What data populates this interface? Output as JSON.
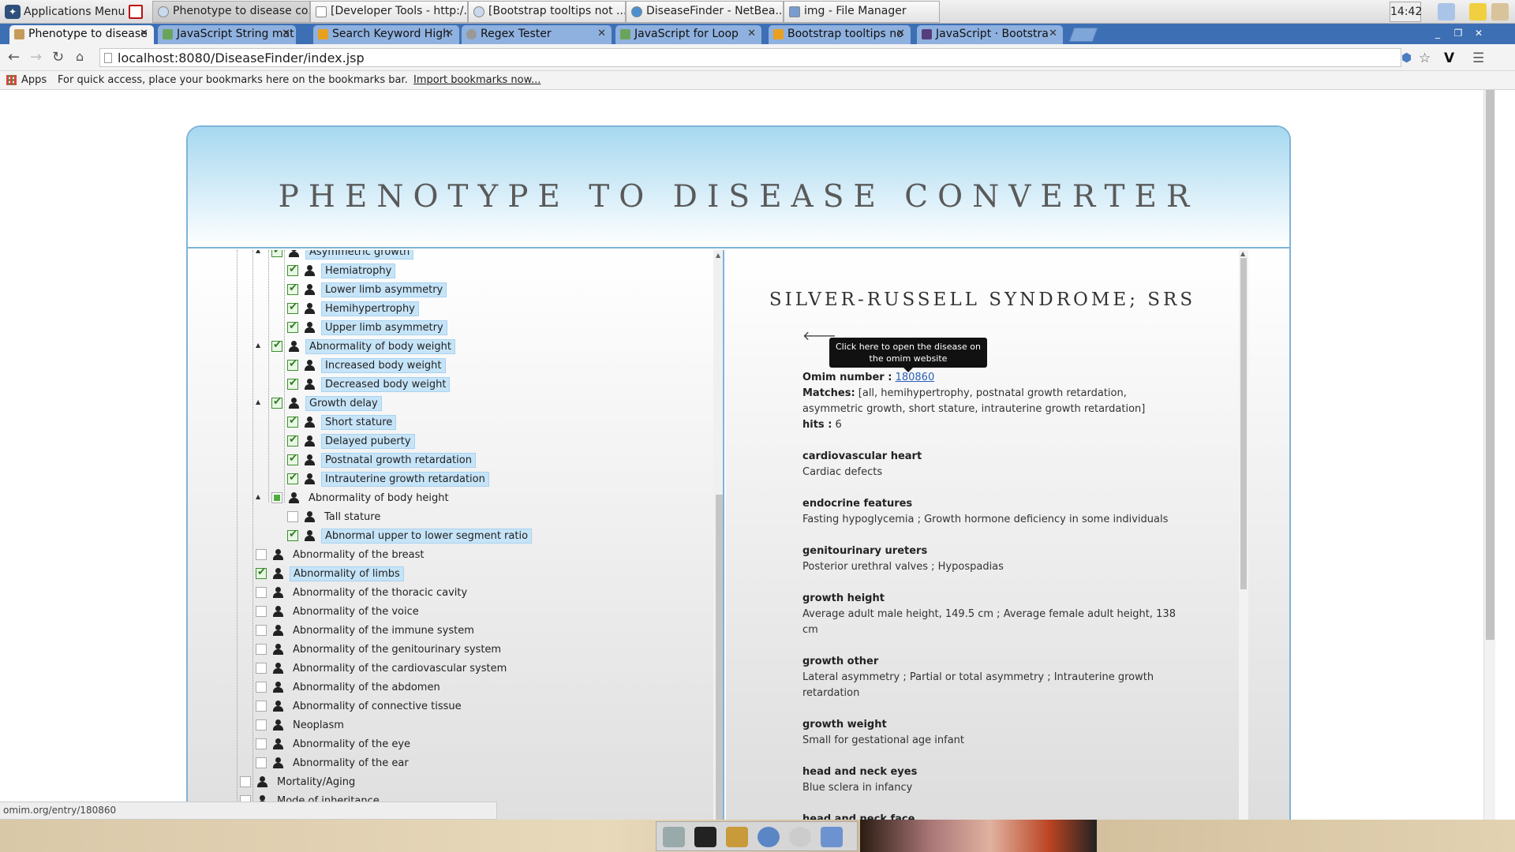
{
  "os_panel": {
    "apps_menu": "Applications Menu",
    "tasks": [
      "Phenotype to disease co...",
      "[Developer Tools - http:/...",
      "[Bootstrap tooltips not ...",
      "DiseaseFinder - NetBea...",
      "img - File Manager"
    ],
    "clock": "14:42"
  },
  "browser": {
    "tabs": [
      "Phenotype to disease",
      "JavaScript String mat",
      "Search Keyword High",
      "Regex Tester",
      "JavaScript for Loop",
      "Bootstrap tooltips no",
      "JavaScript · Bootstra"
    ],
    "url": "localhost:8080/DiseaseFinder/index.jsp",
    "bookmarks": {
      "apps_label": "Apps",
      "message": "For quick access, place your bookmarks here on the bookmarks bar.",
      "import_link": "Import bookmarks now..."
    },
    "status_url": "omim.org/entry/180860"
  },
  "app": {
    "title": "PHENOTYPE TO DISEASE CONVERTER",
    "tree": [
      {
        "label": "Asymmetric growth",
        "checked": true
      },
      {
        "label": "Hemiatrophy",
        "checked": true
      },
      {
        "label": "Lower limb asymmetry",
        "checked": true
      },
      {
        "label": "Hemihypertrophy",
        "checked": true
      },
      {
        "label": "Upper limb asymmetry",
        "checked": true
      },
      {
        "label": "Abnormality of body weight",
        "checked": true
      },
      {
        "label": "Increased body weight",
        "checked": true
      },
      {
        "label": "Decreased body weight",
        "checked": true
      },
      {
        "label": "Growth delay",
        "checked": true
      },
      {
        "label": "Short stature",
        "checked": true
      },
      {
        "label": "Delayed puberty",
        "checked": true
      },
      {
        "label": "Postnatal growth retardation",
        "checked": true
      },
      {
        "label": "Intrauterine growth retardation",
        "checked": true
      },
      {
        "label": "Abnormality of body height",
        "checked": false,
        "partial": true
      },
      {
        "label": "Tall stature",
        "checked": false
      },
      {
        "label": "Abnormal upper to lower segment ratio",
        "checked": true
      },
      {
        "label": "Abnormality of the breast",
        "checked": false
      },
      {
        "label": "Abnormality of limbs",
        "checked": true
      },
      {
        "label": "Abnormality of the thoracic cavity",
        "checked": false
      },
      {
        "label": "Abnormality of the voice",
        "checked": false
      },
      {
        "label": "Abnormality of the immune system",
        "checked": false
      },
      {
        "label": "Abnormality of the genitourinary system",
        "checked": false
      },
      {
        "label": "Abnormality of the cardiovascular system",
        "checked": false
      },
      {
        "label": "Abnormality of the abdomen",
        "checked": false
      },
      {
        "label": "Abnormality of connective tissue",
        "checked": false
      },
      {
        "label": "Neoplasm",
        "checked": false
      },
      {
        "label": "Abnormality of the eye",
        "checked": false
      },
      {
        "label": "Abnormality of the ear",
        "checked": false
      },
      {
        "label": "Mortality/Aging",
        "checked": false
      },
      {
        "label": "Mode of inheritance",
        "checked": false
      }
    ],
    "disease": {
      "name": "SILVER-RUSSELL SYNDROME; SRS",
      "tooltip": "Click here to open the disease on the omim website",
      "omim_label": "Omim number :",
      "omim_number": "180860",
      "matches_label": "Matches:",
      "matches": "[all, hemihypertrophy, postnatal growth retardation, asymmetric growth, short stature, intrauterine growth retardation]",
      "hits_label": "hits :",
      "hits": "6",
      "sections": [
        {
          "heading": "cardiovascular heart",
          "text": "Cardiac defects"
        },
        {
          "heading": "endocrine features",
          "text": "Fasting hypoglycemia ; Growth hormone deficiency in some individuals"
        },
        {
          "heading": "genitourinary ureters",
          "text": "Posterior urethral valves ; Hypospadias"
        },
        {
          "heading": "growth height",
          "text": "Average adult male height, 149.5 cm ; Average female adult height, 138 cm"
        },
        {
          "heading": "growth other",
          "text": "Lateral asymmetry ; Partial or total asymmetry ; Intrauterine growth retardation"
        },
        {
          "heading": "growth weight",
          "text": "Small for gestational age infant"
        },
        {
          "heading": "head and neck eyes",
          "text": "Blue sclera in infancy"
        },
        {
          "heading": "head and neck face",
          "text": ""
        }
      ]
    }
  }
}
